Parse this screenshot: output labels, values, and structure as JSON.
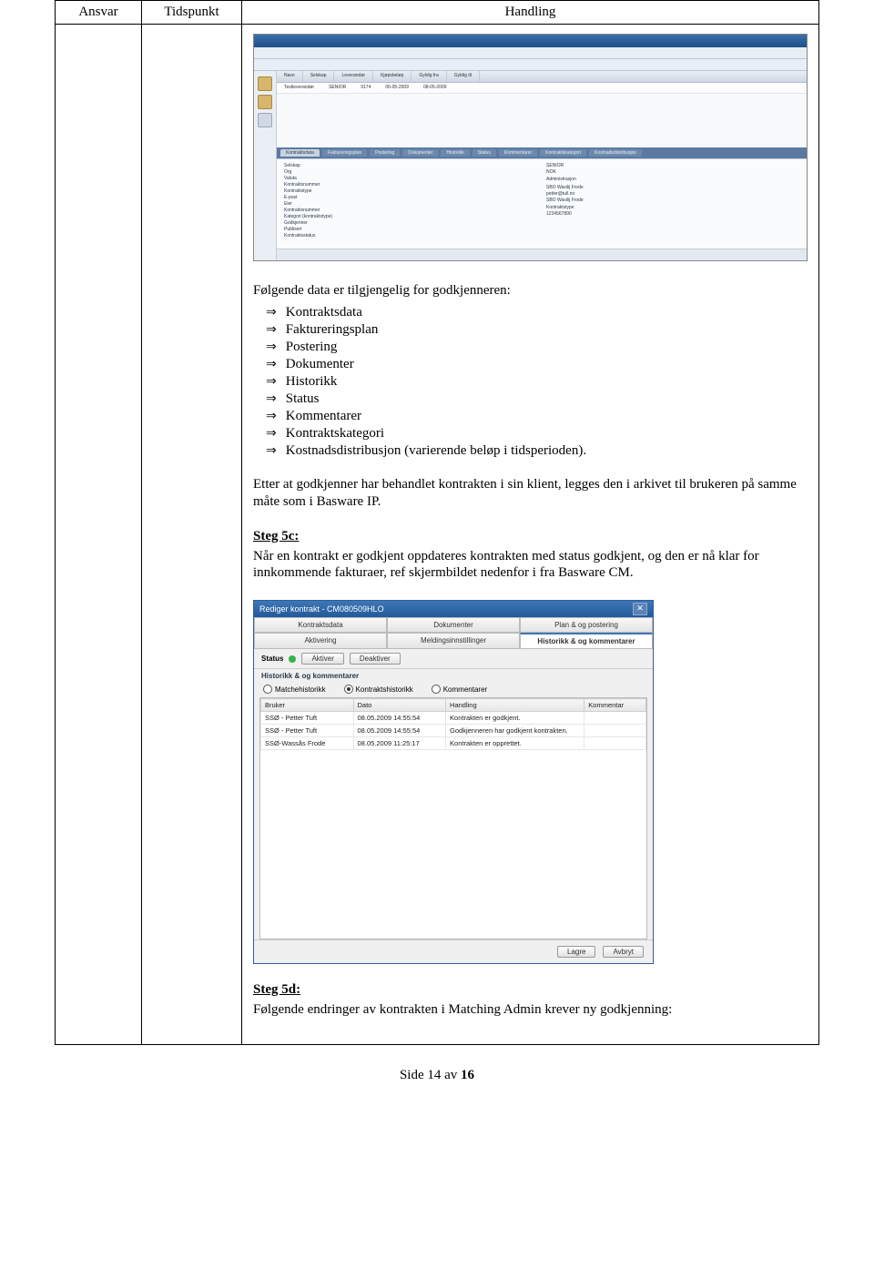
{
  "table_headers": {
    "col1": "Ansvar",
    "col2": "Tidspunkt",
    "col3": "Handling"
  },
  "screenshot1": {
    "side_icons": [
      "folder-icon",
      "folder-icon",
      "task-icon"
    ],
    "list_headers": [
      "",
      "Navn",
      "Selskap",
      "Leverandør",
      "Kjøpsbeløp",
      "Gyldig fra",
      "Gyldig til"
    ],
    "list_row": [
      "",
      "Testleverandør",
      "SENIOR",
      "9174",
      "06-05-2009",
      "08-05-2009"
    ],
    "tabs": [
      "Kontraktsdata",
      "Faktureringsplan",
      "Postering",
      "Dokumenter",
      "Historikk",
      "Status",
      "Kommentarer",
      "Kontraktskategori",
      "Kostnadsdistribusjon"
    ],
    "details_left": [
      "Selskap",
      "Org",
      "Valuta",
      "Kontraktsnummer",
      "Kontraktstype",
      "E-post",
      "Eier",
      "Kontraktsnummer",
      "Kategori (kontraktstype)",
      "Godkjenner",
      "Publisert",
      "Kontraktsstatus"
    ],
    "details_right": [
      "SENIOR",
      "NOK",
      "",
      "Administrasjon",
      "",
      "",
      "SBO Wasilij Frode",
      "petter@tull.no",
      "SBO Wasilij Frode",
      "",
      "Kontraktstype",
      "1234567890"
    ]
  },
  "intro_text": "Følgende data er tilgjengelig for godkjenneren:",
  "bullets": [
    "Kontraktsdata",
    "Faktureringsplan",
    "Postering",
    "Dokumenter",
    "Historikk",
    "Status",
    "Kommentarer",
    "Kontraktskategori",
    "Kostnadsdistribusjon (varierende beløp i tidsperioden)."
  ],
  "para_after_list": "Etter at godkjenner har behandlet kontrakten i sin klient, legges den i arkivet til brukeren på samme måte som i Basware IP.",
  "step5c": {
    "heading": "Steg 5c:",
    "text": "Når en kontrakt er godkjent oppdateres kontrakten med status godkjent, og den er nå klar for innkommende fakturaer, ref skjermbildet nedenfor i fra Basware CM."
  },
  "screenshot2": {
    "title_prefix": "Rediger kontrakt - ",
    "title_code": "CM080509HLO",
    "tabs_row1": [
      "Kontraktsdata",
      "Dokumenter",
      "Plan & og postering"
    ],
    "tabs_row2": [
      "Aktivering",
      "Meldingsinnstillinger",
      "Historikk & og kommentarer"
    ],
    "tabs_selected": "Historikk & og kommentarer",
    "status_label": "Status",
    "btn_aktiver": "Aktiver",
    "btn_deaktiver": "Deaktiver",
    "section_heading": "Historikk & og kommentarer",
    "radios": [
      {
        "label": "Matchehistorikk",
        "selected": false
      },
      {
        "label": "Kontraktshistorikk",
        "selected": true
      },
      {
        "label": "Kommentarer",
        "selected": false
      }
    ],
    "table_headers": [
      "Bruker",
      "Dato",
      "Handling",
      "Kommentar"
    ],
    "rows": [
      {
        "user": "SSØ - Petter Tuft",
        "date": "08.05.2009 14:55:54",
        "action": "Kontrakten er godkjent.",
        "comment": ""
      },
      {
        "user": "SSØ - Petter Tuft",
        "date": "08.05.2009 14:55:54",
        "action": "Godkjenneren har godkjent kontrakten.",
        "comment": ""
      },
      {
        "user": "SSØ-Wassås Frode",
        "date": "08.05.2009 11:25:17",
        "action": "Kontrakten er opprettet.",
        "comment": ""
      }
    ],
    "btn_lagre": "Lagre",
    "btn_avbryt": "Avbryt"
  },
  "step5d": {
    "heading": "Steg 5d:",
    "text": "Følgende endringer av kontrakten i Matching Admin krever ny godkjenning:"
  },
  "footer": {
    "prefix": "Side ",
    "page": "14",
    "mid": " av ",
    "total": "16"
  }
}
